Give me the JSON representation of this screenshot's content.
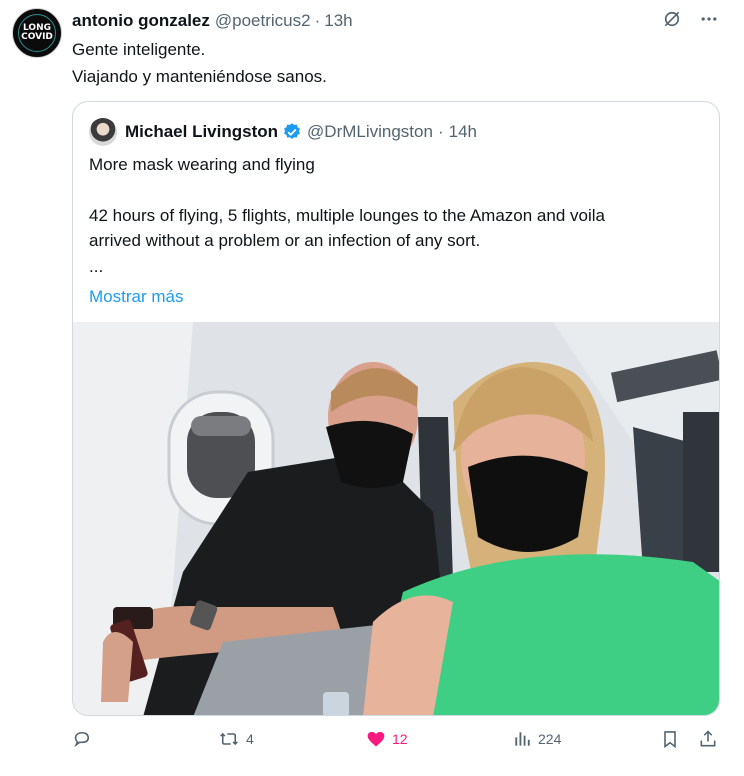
{
  "tweet": {
    "author_name": "antonio gonzalez",
    "handle": "@poetricus2",
    "separator": "·",
    "time": "13h",
    "avatar_text": [
      "LONG",
      "COVID"
    ],
    "text_lines": [
      "Gente inteligente.",
      "Viajando y manteniéndose sanos."
    ]
  },
  "quoted": {
    "author_name": "Michael Livingston",
    "handle": "@DrMLivingston",
    "separator": "·",
    "time": "14h",
    "verified": true,
    "line1": "More mask wearing and flying",
    "line2": "42 hours of flying, 5 flights, multiple lounges to the Amazon and voila",
    "line3": "arrived without a problem or an infection of any sort.",
    "ellipsis": "...",
    "show_more": "Mostrar más"
  },
  "actions": {
    "reply_count": "",
    "retweet_count": "4",
    "like_count": "12",
    "views_count": "224"
  },
  "colors": {
    "accent": "#1d9bf0",
    "like": "#f91880",
    "muted": "#536471",
    "border": "#cfd9de"
  },
  "icons": [
    "grok-icon",
    "more-icon",
    "verified-icon",
    "reply-icon",
    "retweet-icon",
    "like-icon",
    "views-icon",
    "bookmark-icon",
    "share-icon"
  ]
}
